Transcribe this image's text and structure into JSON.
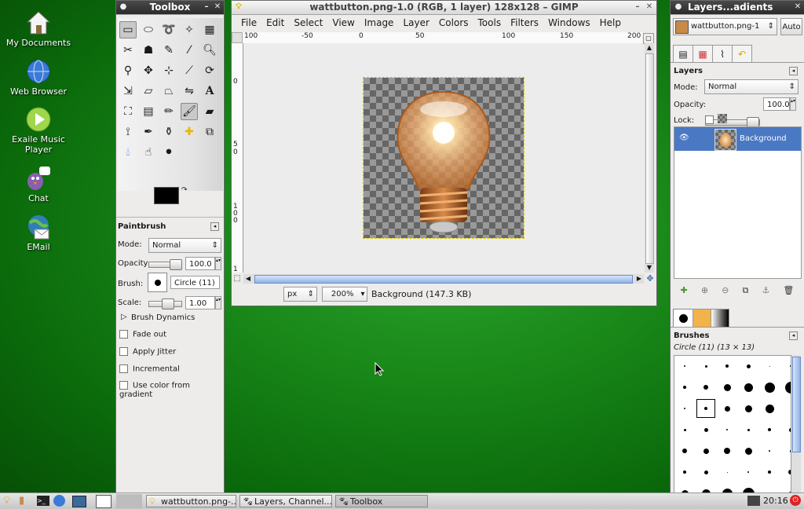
{
  "desktop": {
    "icons": [
      {
        "label": "My Documents",
        "icon": "home-icon"
      },
      {
        "label": "Web Browser",
        "icon": "globe-icon"
      },
      {
        "label_line1": "Exaile Music",
        "label_line2": "Player",
        "icon": "play-icon"
      },
      {
        "label": "Chat",
        "icon": "chat-bird-icon"
      },
      {
        "label": "EMail",
        "icon": "email-globe-icon"
      }
    ]
  },
  "toolbox": {
    "title": "Toolbox",
    "tool_options_title": "Paintbrush",
    "mode_label": "Mode:",
    "mode_value": "Normal",
    "opacity_label": "Opacity:",
    "opacity_value": "100.0",
    "brush_label": "Brush:",
    "brush_value": "Circle (11)",
    "scale_label": "Scale:",
    "scale_value": "1.00",
    "brush_dynamics": "Brush Dynamics",
    "fade_out": "Fade out",
    "apply_jitter": "Apply Jitter",
    "incremental": "Incremental",
    "use_color_from_gradient": "Use color from gradient"
  },
  "image_window": {
    "title": "wattbutton.png-1.0 (RGB, 1 layer) 128x128 – GIMP",
    "menu": [
      "File",
      "Edit",
      "Select",
      "View",
      "Image",
      "Layer",
      "Colors",
      "Tools",
      "Filters",
      "Windows",
      "Help"
    ],
    "ruler_h": [
      "100",
      "-50",
      "0",
      "50",
      "100",
      "150",
      "200"
    ],
    "ruler_v": [
      "0",
      "5",
      "0",
      "1",
      "0",
      "0",
      "1"
    ],
    "unit": "px",
    "zoom": "200%",
    "status": "Background (147.3 KB)"
  },
  "layers_window": {
    "title": "Layers...adients",
    "image_select": "wattbutton.png-1",
    "auto_button": "Auto",
    "layers_heading": "Layers",
    "mode_label": "Mode:",
    "mode_value": "Normal",
    "opacity_label": "Opacity:",
    "opacity_value": "100.0",
    "lock_label": "Lock:",
    "layer_name": "Background",
    "brushes_heading": "Brushes",
    "brush_info": "Circle (11) (13 × 13)"
  },
  "taskbar": {
    "tasks": [
      "wattbutton.png-...",
      "Layers, Channel...",
      "Toolbox"
    ],
    "clock": "20:16"
  },
  "colors": {
    "selection_blue": "#4a78c2",
    "desktop_green": "#1a8a1a"
  }
}
